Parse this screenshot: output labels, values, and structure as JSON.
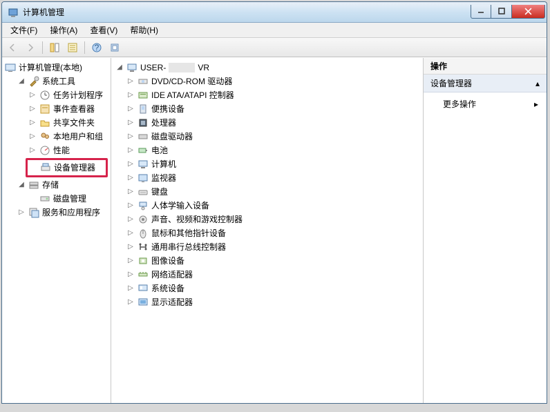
{
  "window": {
    "title": "计算机管理",
    "buttons": {
      "min": "minimize",
      "max": "maximize",
      "close": "close"
    }
  },
  "menubar": [
    "文件(F)",
    "操作(A)",
    "查看(V)",
    "帮助(H)"
  ],
  "left_tree": {
    "root": "计算机管理(本地)",
    "system_tools": {
      "label": "系统工具",
      "items": [
        "任务计划程序",
        "事件查看器",
        "共享文件夹",
        "本地用户和组",
        "性能"
      ],
      "device_manager": "设备管理器"
    },
    "storage": {
      "label": "存储",
      "items": [
        "磁盘管理"
      ]
    },
    "services": "服务和应用程序"
  },
  "mid_tree": {
    "root_prefix": "USER-",
    "root_suffix": "VR",
    "items": [
      "DVD/CD-ROM 驱动器",
      "IDE ATA/ATAPI 控制器",
      "便携设备",
      "处理器",
      "磁盘驱动器",
      "电池",
      "计算机",
      "监视器",
      "键盘",
      "人体学输入设备",
      "声音、视频和游戏控制器",
      "鼠标和其他指针设备",
      "通用串行总线控制器",
      "图像设备",
      "网络适配器",
      "系统设备",
      "显示适配器"
    ]
  },
  "right_pane": {
    "header": "操作",
    "section": "设备管理器",
    "link": "更多操作"
  }
}
